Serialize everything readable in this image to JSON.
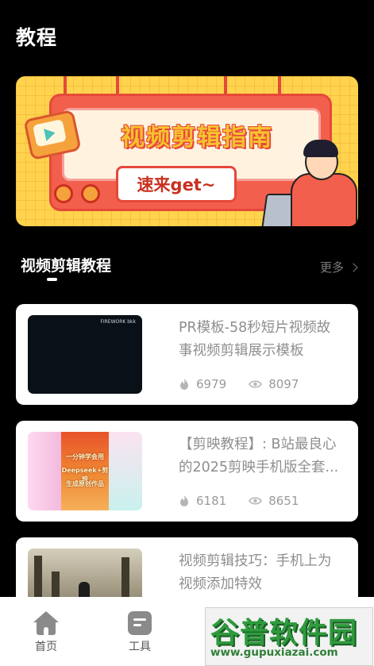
{
  "header": {
    "title": "教程"
  },
  "banner": {
    "headline": "视频剪辑指南",
    "button_text": "速来get~"
  },
  "section": {
    "title": "视频剪辑教程",
    "more_label": "更多"
  },
  "cards": [
    {
      "title": "PR模板-58秒短片视频故事视频剪辑展示模板",
      "likes": "6979",
      "views": "8097",
      "thumb_watermark": "FIREWORK bkk"
    },
    {
      "title": "【剪映教程】: B站最良心的2025剪映手机版全套...",
      "likes": "6181",
      "views": "8651",
      "thumb_lines": [
        "一分钟学会用",
        "Deepseek+剪映",
        "生成原创作品"
      ]
    },
    {
      "title": "视频剪辑技巧：手机上为视频添加特效",
      "likes": "",
      "views": ""
    }
  ],
  "nav": {
    "items": [
      {
        "label": "首页"
      },
      {
        "label": "工具"
      }
    ]
  },
  "watermark": {
    "brand": "谷普软件园",
    "url": "www.gupuxiazai.com"
  },
  "colors": {
    "background": "#000000",
    "card": "#ffffff",
    "banner_yellow": "#ffd34d",
    "banner_red": "#f25f4c"
  }
}
